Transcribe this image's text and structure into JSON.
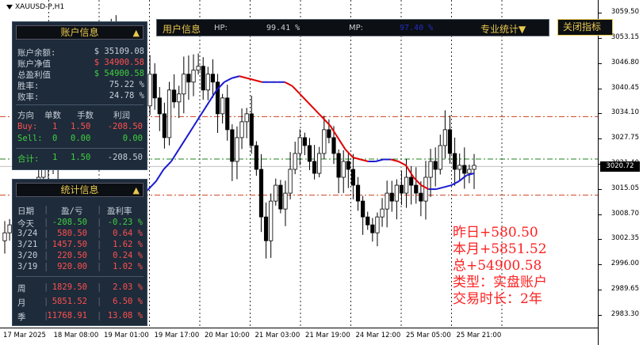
{
  "symbol": "XAUUSD-P,H1",
  "colors": {
    "bull": "#000000",
    "ma_up": "#1a1ad0",
    "ma_down": "#e00000",
    "panel_bg": "#1e2b3a",
    "header_yellow": "#e8c850",
    "profit_green": "#40d040",
    "loss_red": "#ff5050",
    "dash_red": "#d04020",
    "dash_green": "#208020"
  },
  "account_panel": {
    "title": "账户信息",
    "rows": [
      {
        "label": "账户余额:",
        "value": "$ 35109.08"
      },
      {
        "label": "账户净值",
        "value": "$ 34900.58"
      },
      {
        "label": "总盈利值",
        "value": "$ 54900.58"
      },
      {
        "label": "胜率:",
        "value": "75.22 %"
      },
      {
        "label": "败率:",
        "value": "24.78 %"
      }
    ],
    "table_headers": [
      "方向",
      "单数",
      "手数",
      "利润"
    ],
    "positions": [
      {
        "dir": "Buy:",
        "count": "1",
        "lots": "1.50",
        "profit": "-208.50"
      },
      {
        "dir": "Sell:",
        "count": "0",
        "lots": "0.00",
        "profit": "0.00"
      }
    ],
    "total": {
      "dir": "合计:",
      "count": "1",
      "lots": "1.50",
      "profit": "-208.50"
    }
  },
  "stats_panel": {
    "title": "统计信息",
    "headers": [
      "日期",
      "盈/亏",
      "盈利率"
    ],
    "rows": [
      {
        "date": "今天",
        "pl": "-208.50",
        "rate": "-0.23 %"
      },
      {
        "date": "3/24",
        "pl": "580.50",
        "rate": "0.64 %"
      },
      {
        "date": "3/21",
        "pl": "1457.50",
        "rate": "1.62 %"
      },
      {
        "date": "3/20",
        "pl": "220.50",
        "rate": "0.24 %"
      },
      {
        "date": "3/19",
        "pl": "920.00",
        "rate": "1.02 %"
      }
    ],
    "periods": [
      {
        "date": "周",
        "pl": "1829.50",
        "rate": "2.03 %"
      },
      {
        "date": "月",
        "pl": "5851.52",
        "rate": "6.50 %"
      },
      {
        "date": "季",
        "pl": "11768.91",
        "rate": "13.08 %"
      }
    ]
  },
  "top_bar": {
    "title": "用户信息",
    "hp_label": "HP:",
    "hp_value": "99.41 %",
    "mp_label": "MP:",
    "mp_value": "97.40 %",
    "pro_stats": "专业统计▼"
  },
  "close_button": "关闭指标",
  "overlay_lines": [
    "昨日+580.50",
    "本月+5851.52",
    "总+54900.58",
    "类型：实盘账户",
    "交易时长：2年"
  ],
  "y_axis_labels": [
    "3059.50",
    "3053.15",
    "3046.80",
    "3040.45",
    "3034.10",
    "3027.75",
    "3021.40",
    "3015.05",
    "3008.70",
    "3002.35",
    "2996.00",
    "2989.65",
    "2983.30"
  ],
  "current_price": "3020.72",
  "x_axis_labels": [
    "17 Mar 2025",
    "18 Mar 08:00",
    "19 Mar 01:00",
    "19 Mar 17:00",
    "20 Mar 10:00",
    "21 Mar 03:00",
    "21 Mar 19:00",
    "24 Mar 12:00",
    "25 Mar 05:00",
    "25 Mar 21:00"
  ],
  "chart_data": {
    "type": "candlestick",
    "y_range": [
      2980.1,
      3062.7
    ],
    "y_ticks": [
      3059.5,
      3053.15,
      3046.8,
      3040.45,
      3034.1,
      3027.75,
      3021.4,
      3015.05,
      3008.7,
      3002.35,
      2996.0,
      2989.65,
      2983.3
    ],
    "current_price": 3020.72,
    "levels": [
      {
        "price": 3033.3,
        "style": "dash-dot",
        "color": "red"
      },
      {
        "price": 3022.6,
        "style": "dash-dot",
        "color": "green"
      },
      {
        "price": 3013.5,
        "style": "dash-dot",
        "color": "red"
      }
    ],
    "closes": [
      3004,
      3006,
      3003,
      3008,
      3009,
      3012,
      3010,
      3018,
      3024,
      3020,
      3021,
      3028,
      3036,
      3031,
      3029,
      3033,
      3040,
      3044,
      3050,
      3047,
      3045,
      3051,
      3056,
      3052,
      3049,
      3046,
      3050,
      3047,
      3041,
      3036,
      3044,
      3038,
      3034,
      3028,
      3040,
      3037,
      3039,
      3044,
      3042,
      3045,
      3046,
      3040,
      3044,
      3042,
      3034,
      3038,
      3030,
      3022,
      3028,
      3032,
      3034,
      3026,
      3020,
      3008,
      3002,
      3012,
      3016,
      3010,
      3014,
      3020,
      3024,
      3028,
      3026,
      3022,
      3019,
      3024,
      3030,
      3028,
      3024,
      3018,
      3022,
      3020,
      3016,
      3012,
      3008,
      3006,
      3004,
      3008,
      3010,
      3014,
      3012,
      3016,
      3014,
      3018,
      3016,
      3014,
      3012,
      3018,
      3022,
      3020,
      3026,
      3030,
      3024,
      3020,
      3021,
      3019,
      3020,
      3021
    ],
    "ma": [
      3006,
      3007,
      3008,
      3009,
      3011,
      3013,
      3015,
      3017,
      3020,
      3022,
      3025,
      3028,
      3031,
      3034,
      3037,
      3040,
      3042,
      3043,
      3043.5,
      3043,
      3042.5,
      3042,
      3042,
      3042,
      3042,
      3041,
      3039,
      3037,
      3035,
      3033,
      3031,
      3028,
      3025,
      3023,
      3022.5,
      3022,
      3022,
      3022.5,
      3022.5,
      3022,
      3021,
      3018,
      3016,
      3015,
      3015,
      3015.5,
      3016,
      3017,
      3018.5,
      3019
    ]
  }
}
